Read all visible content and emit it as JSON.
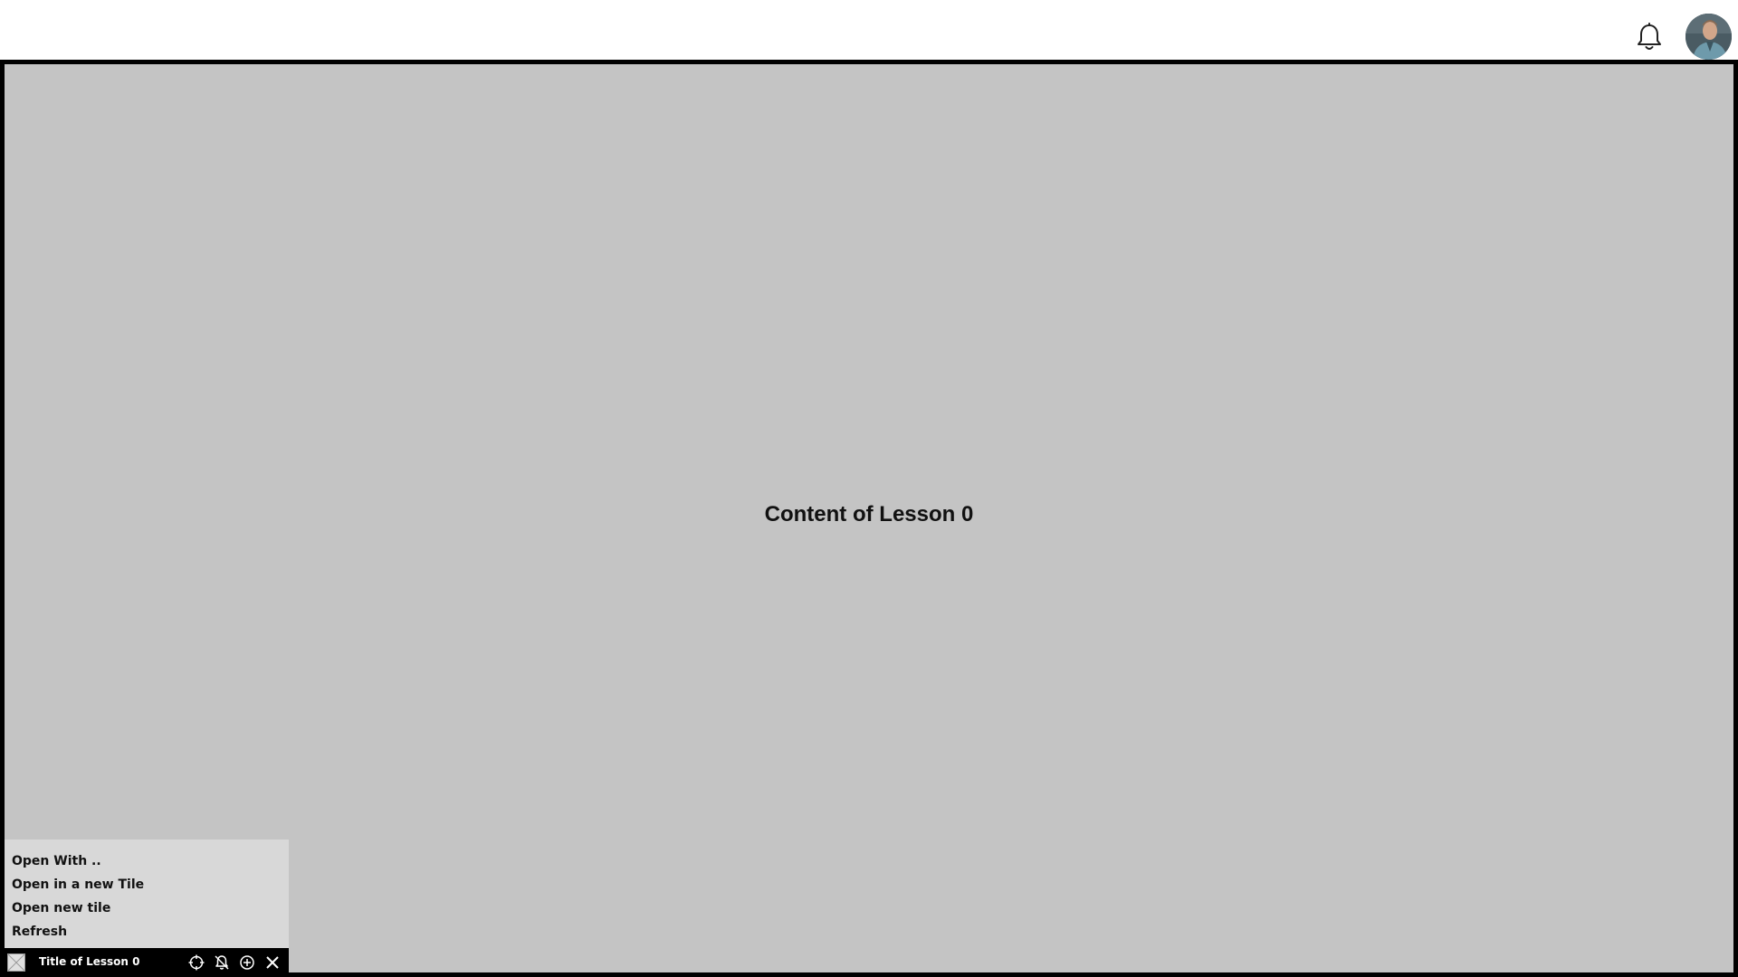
{
  "header": {
    "notification_icon": "bell-icon",
    "avatar_icon": "user-avatar"
  },
  "main": {
    "content_text": "Content of Lesson 0"
  },
  "context_menu": {
    "items": [
      {
        "label": "Open With .."
      },
      {
        "label": "Open in a new Tile"
      },
      {
        "label": "Open new tile"
      },
      {
        "label": "Refresh"
      }
    ]
  },
  "tile_bar": {
    "title": "Title of Lesson 0",
    "thumbnail_icon": "broken-image-icon",
    "icons": [
      "crosshair-icon",
      "bell-off-icon",
      "plus-circle-icon",
      "close-icon"
    ]
  },
  "colors": {
    "content_bg": "#c4c4c4",
    "menu_bg": "#d8d8d8",
    "tilebar_bg": "#000000"
  }
}
